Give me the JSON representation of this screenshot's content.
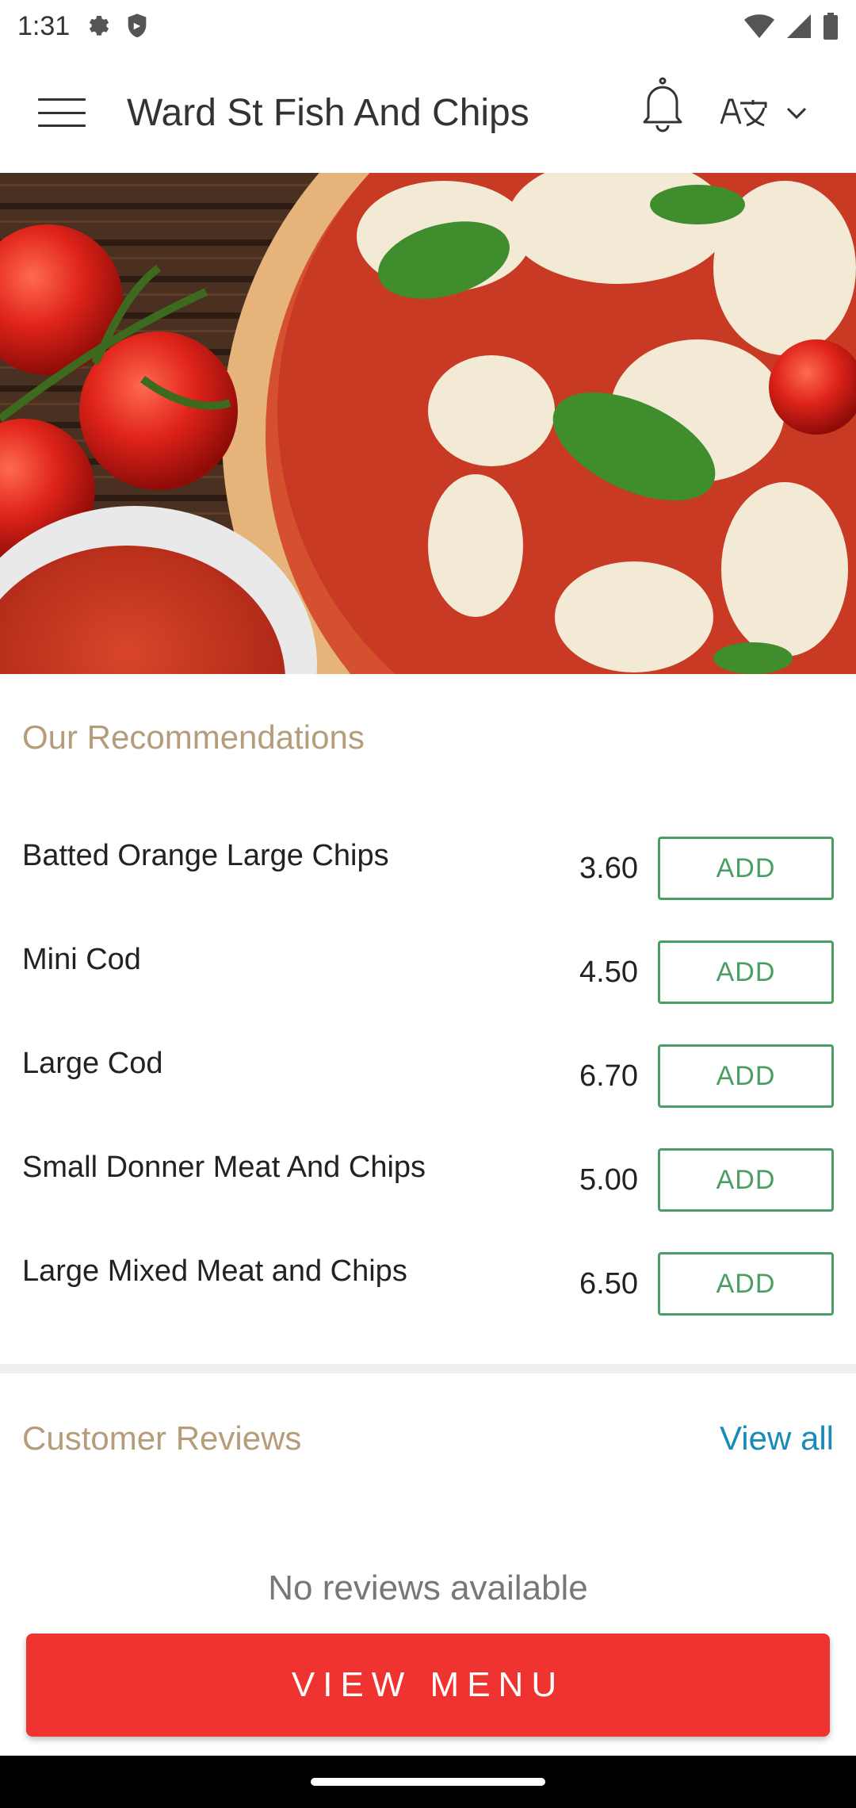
{
  "status_bar": {
    "time": "1:31"
  },
  "app_bar": {
    "title": "Ward St Fish And Chips"
  },
  "recommendations": {
    "title": "Our Recommendations",
    "add_label": "ADD",
    "items": [
      {
        "name": "Batted Orange Large Chips",
        "price": "3.60"
      },
      {
        "name": "Mini Cod",
        "price": "4.50"
      },
      {
        "name": "Large Cod",
        "price": "6.70"
      },
      {
        "name": "Small Donner Meat And Chips",
        "price": "5.00"
      },
      {
        "name": "Large Mixed Meat and Chips",
        "price": "6.50"
      }
    ]
  },
  "reviews": {
    "title": "Customer Reviews",
    "view_all": "View all",
    "empty_text": "No reviews available"
  },
  "footer": {
    "view_menu": "VIEW MENU"
  },
  "icons": {
    "status": [
      "settings-icon",
      "shield-icon",
      "wifi-icon",
      "signal-icon",
      "battery-icon"
    ],
    "app_bar": [
      "hamburger-menu-icon",
      "bell-icon",
      "language-icon",
      "chevron-down-icon"
    ]
  },
  "colors": {
    "section_title": "#b59d7c",
    "add_button": "#4b9e63",
    "view_all_link": "#1a8ab8",
    "view_menu_button": "#ee3330"
  }
}
